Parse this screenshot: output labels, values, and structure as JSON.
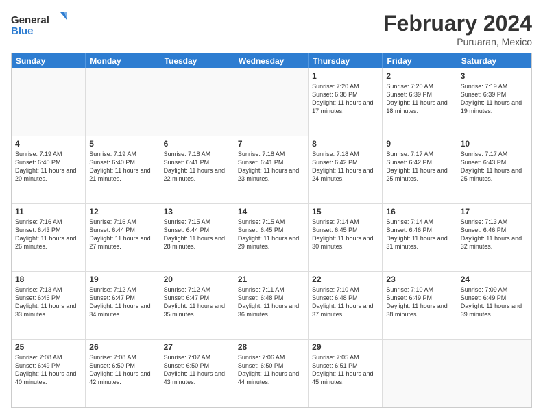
{
  "header": {
    "logo_general": "General",
    "logo_blue": "Blue",
    "title": "February 2024",
    "subtitle": "Puruaran, Mexico"
  },
  "days_of_week": [
    "Sunday",
    "Monday",
    "Tuesday",
    "Wednesday",
    "Thursday",
    "Friday",
    "Saturday"
  ],
  "weeks": [
    [
      {
        "day": "",
        "empty": true
      },
      {
        "day": "",
        "empty": true
      },
      {
        "day": "",
        "empty": true
      },
      {
        "day": "",
        "empty": true
      },
      {
        "day": "1",
        "sunrise": "7:20 AM",
        "sunset": "6:38 PM",
        "daylight": "11 hours and 17 minutes."
      },
      {
        "day": "2",
        "sunrise": "7:20 AM",
        "sunset": "6:39 PM",
        "daylight": "11 hours and 18 minutes."
      },
      {
        "day": "3",
        "sunrise": "7:19 AM",
        "sunset": "6:39 PM",
        "daylight": "11 hours and 19 minutes."
      }
    ],
    [
      {
        "day": "4",
        "sunrise": "7:19 AM",
        "sunset": "6:40 PM",
        "daylight": "11 hours and 20 minutes."
      },
      {
        "day": "5",
        "sunrise": "7:19 AM",
        "sunset": "6:40 PM",
        "daylight": "11 hours and 21 minutes."
      },
      {
        "day": "6",
        "sunrise": "7:18 AM",
        "sunset": "6:41 PM",
        "daylight": "11 hours and 22 minutes."
      },
      {
        "day": "7",
        "sunrise": "7:18 AM",
        "sunset": "6:41 PM",
        "daylight": "11 hours and 23 minutes."
      },
      {
        "day": "8",
        "sunrise": "7:18 AM",
        "sunset": "6:42 PM",
        "daylight": "11 hours and 24 minutes."
      },
      {
        "day": "9",
        "sunrise": "7:17 AM",
        "sunset": "6:42 PM",
        "daylight": "11 hours and 25 minutes."
      },
      {
        "day": "10",
        "sunrise": "7:17 AM",
        "sunset": "6:43 PM",
        "daylight": "11 hours and 25 minutes."
      }
    ],
    [
      {
        "day": "11",
        "sunrise": "7:16 AM",
        "sunset": "6:43 PM",
        "daylight": "11 hours and 26 minutes."
      },
      {
        "day": "12",
        "sunrise": "7:16 AM",
        "sunset": "6:44 PM",
        "daylight": "11 hours and 27 minutes."
      },
      {
        "day": "13",
        "sunrise": "7:15 AM",
        "sunset": "6:44 PM",
        "daylight": "11 hours and 28 minutes."
      },
      {
        "day": "14",
        "sunrise": "7:15 AM",
        "sunset": "6:45 PM",
        "daylight": "11 hours and 29 minutes."
      },
      {
        "day": "15",
        "sunrise": "7:14 AM",
        "sunset": "6:45 PM",
        "daylight": "11 hours and 30 minutes."
      },
      {
        "day": "16",
        "sunrise": "7:14 AM",
        "sunset": "6:46 PM",
        "daylight": "11 hours and 31 minutes."
      },
      {
        "day": "17",
        "sunrise": "7:13 AM",
        "sunset": "6:46 PM",
        "daylight": "11 hours and 32 minutes."
      }
    ],
    [
      {
        "day": "18",
        "sunrise": "7:13 AM",
        "sunset": "6:46 PM",
        "daylight": "11 hours and 33 minutes."
      },
      {
        "day": "19",
        "sunrise": "7:12 AM",
        "sunset": "6:47 PM",
        "daylight": "11 hours and 34 minutes."
      },
      {
        "day": "20",
        "sunrise": "7:12 AM",
        "sunset": "6:47 PM",
        "daylight": "11 hours and 35 minutes."
      },
      {
        "day": "21",
        "sunrise": "7:11 AM",
        "sunset": "6:48 PM",
        "daylight": "11 hours and 36 minutes."
      },
      {
        "day": "22",
        "sunrise": "7:10 AM",
        "sunset": "6:48 PM",
        "daylight": "11 hours and 37 minutes."
      },
      {
        "day": "23",
        "sunrise": "7:10 AM",
        "sunset": "6:49 PM",
        "daylight": "11 hours and 38 minutes."
      },
      {
        "day": "24",
        "sunrise": "7:09 AM",
        "sunset": "6:49 PM",
        "daylight": "11 hours and 39 minutes."
      }
    ],
    [
      {
        "day": "25",
        "sunrise": "7:08 AM",
        "sunset": "6:49 PM",
        "daylight": "11 hours and 40 minutes."
      },
      {
        "day": "26",
        "sunrise": "7:08 AM",
        "sunset": "6:50 PM",
        "daylight": "11 hours and 42 minutes."
      },
      {
        "day": "27",
        "sunrise": "7:07 AM",
        "sunset": "6:50 PM",
        "daylight": "11 hours and 43 minutes."
      },
      {
        "day": "28",
        "sunrise": "7:06 AM",
        "sunset": "6:50 PM",
        "daylight": "11 hours and 44 minutes."
      },
      {
        "day": "29",
        "sunrise": "7:05 AM",
        "sunset": "6:51 PM",
        "daylight": "11 hours and 45 minutes."
      },
      {
        "day": "",
        "empty": true
      },
      {
        "day": "",
        "empty": true
      }
    ]
  ]
}
